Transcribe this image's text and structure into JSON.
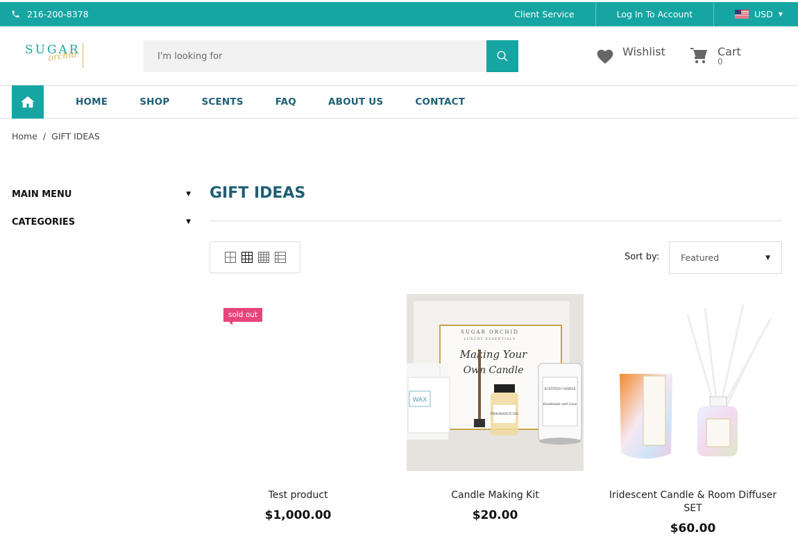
{
  "topbar": {
    "phone": "216-200-8378",
    "client_service": "Client Service",
    "login": "Log In To Account",
    "currency": "USD"
  },
  "brand": {
    "logo_text_top": "SUGAR",
    "logo_text_script": "orchid"
  },
  "search": {
    "placeholder": "I'm looking for"
  },
  "header": {
    "wishlist": "Wishlist",
    "cart_label": "Cart",
    "cart_count": "0"
  },
  "nav": {
    "items": [
      "HOME",
      "SHOP",
      "SCENTS",
      "FAQ",
      "ABOUT US",
      "CONTACT"
    ]
  },
  "breadcrumb": {
    "home": "Home",
    "sep": "/",
    "current": "GIFT IDEAS"
  },
  "sidebar": {
    "items": [
      "MAIN MENU",
      "CATEGORIES"
    ]
  },
  "page": {
    "title": "GIFT IDEAS",
    "sort_label": "Sort by:",
    "sort_value": "Featured"
  },
  "products": [
    {
      "name": "Test product",
      "price": "$1,000.00",
      "badge": "sold out"
    },
    {
      "name": "Candle Making Kit",
      "price": "$20.00",
      "img_box_lines": [
        "SUGAR ORCHID",
        "LUXURY ESSENTIALS",
        "Making Your",
        "Own Candle"
      ],
      "img_labels": [
        "WAX",
        "FRAGRANCE OIL",
        "SCENTED CANDLE",
        "Handmade with Love"
      ]
    },
    {
      "name": "Iridescent Candle & Room Diffuser SET",
      "price": "$60.00"
    }
  ],
  "colors": {
    "accent": "#16a5a3",
    "nav_text": "#1f5f74",
    "badge": "#e8457d"
  }
}
